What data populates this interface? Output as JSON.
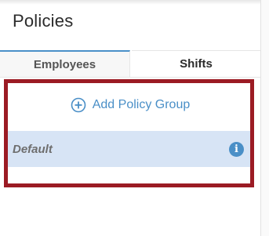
{
  "header": {
    "title": "Policies"
  },
  "tabs": [
    {
      "label": "Employees",
      "active": true
    },
    {
      "label": "Shifts",
      "active": false
    }
  ],
  "actions": {
    "add_policy_group_label": "Add Policy Group"
  },
  "policy_groups": [
    {
      "label": "Default"
    }
  ],
  "colors": {
    "accent": "#4a8fc7",
    "highlight_border": "#9b1b24",
    "selected_row": "#d7e4f5"
  },
  "icons": {
    "add": "plus-circle-icon",
    "info": "info-icon"
  }
}
